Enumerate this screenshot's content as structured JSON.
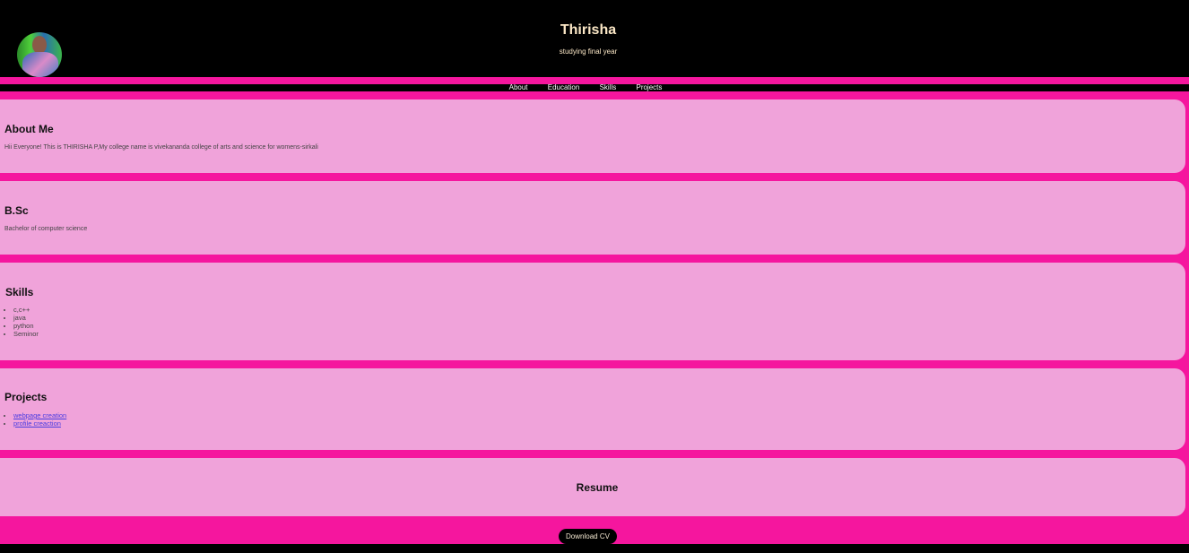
{
  "header": {
    "name": "Thirisha",
    "tagline": "studying final year",
    "avatar_icon": "profile-photo"
  },
  "nav": [
    "About",
    "Education",
    "Skills",
    "Projects"
  ],
  "about": {
    "title": "About Me",
    "text": "Hii Everyone! This is THIRISHA P,My college name is vivekananda college of arts and science for womens-sirkali"
  },
  "education": {
    "title": "B.Sc",
    "text": "Bachelor of computer science"
  },
  "skills": {
    "title": "Skills",
    "items": [
      "c,c++",
      "java",
      "python",
      "Seminor"
    ]
  },
  "projects": {
    "title": "Projects",
    "items": [
      "webpage creation",
      "profile creaction"
    ]
  },
  "resume": {
    "title": "Resume",
    "button": "Download CV"
  },
  "colors": {
    "background": "#f5169e",
    "card": "#f0a3da",
    "header": "#000000"
  }
}
